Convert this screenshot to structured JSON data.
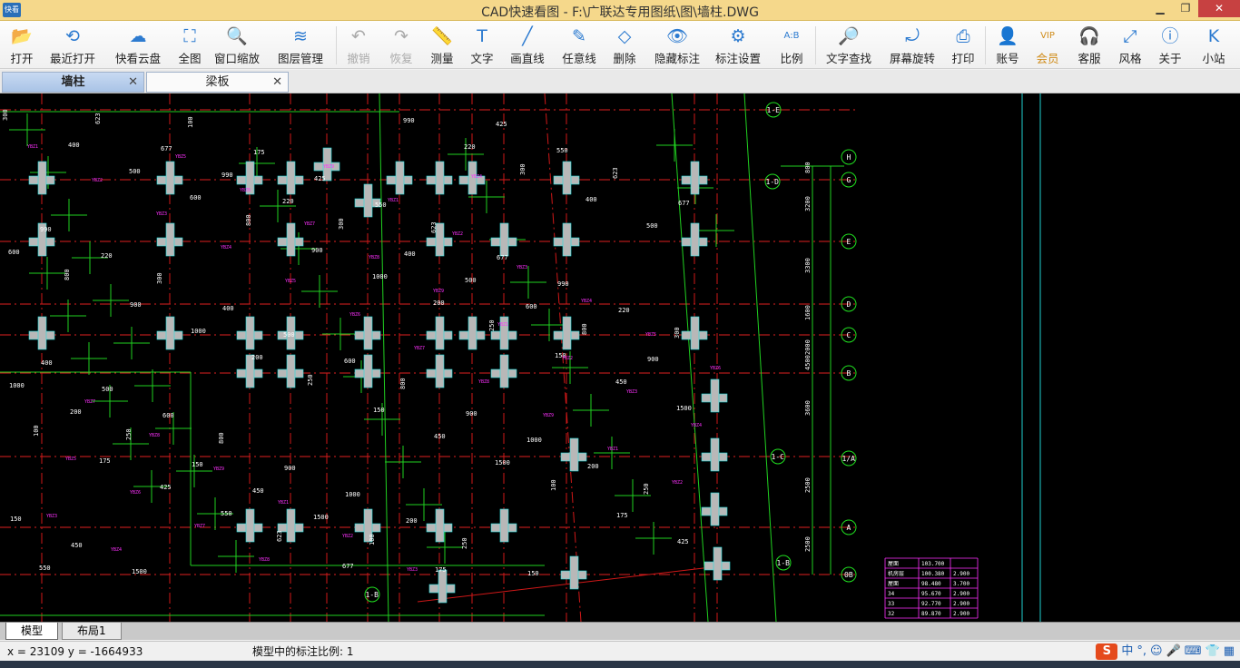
{
  "window": {
    "app_logo": "快看",
    "title": "CAD快速看图 - F:\\广联达专用图纸\\图\\墙柱.DWG",
    "controls": {
      "minimize": "▁",
      "maximize": "❐",
      "close": "✕"
    }
  },
  "toolbar": {
    "buttons": [
      {
        "label": "打开",
        "icon": "folder-open-icon",
        "glyph": "📂"
      },
      {
        "label": "最近打开",
        "icon": "recent-clock-icon",
        "glyph": "⟲"
      },
      {
        "label": "快看云盘",
        "icon": "cloud-icon",
        "glyph": "☁"
      },
      {
        "label": "全图",
        "icon": "fit-all-icon",
        "glyph": "⛶"
      },
      {
        "label": "窗口缩放",
        "icon": "window-zoom-icon",
        "glyph": "🔍"
      },
      {
        "label": "图层管理",
        "icon": "layers-icon",
        "glyph": "≋"
      },
      {
        "label": "撤销",
        "icon": "undo-icon",
        "glyph": "↶"
      },
      {
        "label": "恢复",
        "icon": "redo-icon",
        "glyph": "↷"
      },
      {
        "label": "测量",
        "icon": "ruler-icon",
        "glyph": "📏"
      },
      {
        "label": "文字",
        "icon": "text-icon",
        "glyph": "T"
      },
      {
        "label": "画直线",
        "icon": "line-icon",
        "glyph": "╱"
      },
      {
        "label": "任意线",
        "icon": "pen-icon",
        "glyph": "✎"
      },
      {
        "label": "删除",
        "icon": "eraser-icon",
        "glyph": "◇"
      },
      {
        "label": "隐藏标注",
        "icon": "eye-hide-icon",
        "glyph": "👁"
      },
      {
        "label": "标注设置",
        "icon": "settings-icon",
        "glyph": "⚙"
      },
      {
        "label": "比例",
        "icon": "scale-icon",
        "glyph": "A:B"
      },
      {
        "label": "文字查找",
        "icon": "text-search-icon",
        "glyph": "🔎"
      },
      {
        "label": "屏幕旋转",
        "icon": "rotate-screen-icon",
        "glyph": "⤾"
      },
      {
        "label": "打印",
        "icon": "printer-icon",
        "glyph": "⎙"
      },
      {
        "label": "账号",
        "icon": "user-icon",
        "glyph": "👤"
      },
      {
        "label": "会员",
        "icon": "vip-icon",
        "glyph": "VIP"
      },
      {
        "label": "客服",
        "icon": "headset-icon",
        "glyph": "🎧"
      },
      {
        "label": "风格",
        "icon": "style-icon",
        "glyph": "⤢"
      },
      {
        "label": "关于",
        "icon": "info-icon",
        "glyph": "ⓘ"
      },
      {
        "label": "小站",
        "icon": "k-logo-icon",
        "glyph": "K"
      }
    ]
  },
  "tabs": {
    "items": [
      {
        "label": "墙柱",
        "close": "✕"
      },
      {
        "label": "梁板",
        "close": "✕"
      }
    ]
  },
  "drawing": {
    "axis_labels": [
      "H",
      "G",
      "E",
      "D",
      "C",
      "B",
      "1/A",
      "A",
      "0B",
      "1-E",
      "1-D",
      "1-C",
      "1-B",
      "1-B"
    ],
    "dims_right": [
      "800",
      "3200",
      "3300",
      "1600",
      "2000",
      "4500",
      "3600",
      "2500",
      "2500"
    ],
    "column_texts": [
      "300",
      "400",
      "500",
      "600",
      "800",
      "900",
      "1000",
      "200",
      "250",
      "150",
      "450",
      "1500",
      "100",
      "175",
      "425",
      "550",
      "623",
      "677",
      "990",
      "220"
    ],
    "table_rows": [
      [
        "屋面",
        "103.700",
        ""
      ],
      [
        "机房层",
        "100.380",
        "2.900"
      ],
      [
        "屋面",
        "98.480",
        "3.700"
      ],
      [
        "34",
        "95.670",
        "2.900"
      ],
      [
        "33",
        "92.770",
        "2.900"
      ],
      [
        "32",
        "89.870",
        "2.900"
      ]
    ]
  },
  "layout_tabs": [
    "模型",
    "布局1"
  ],
  "status": {
    "coords": "x = 23109  y = -1664933",
    "scale_text": "模型中的标注比例: 1"
  },
  "ime": {
    "logo": "S",
    "lang": "中",
    "punct": "°,"
  }
}
